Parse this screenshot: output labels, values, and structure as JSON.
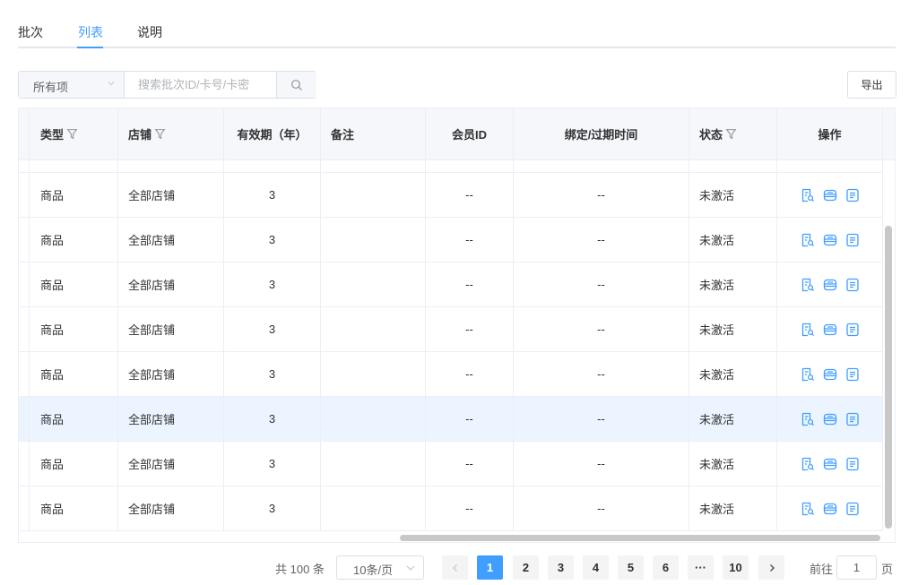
{
  "tabs": [
    {
      "label": "批次",
      "active": false
    },
    {
      "label": "列表",
      "active": true
    },
    {
      "label": "说明",
      "active": false
    }
  ],
  "search": {
    "select_value": "所有项",
    "placeholder": "搜索批次ID/卡号/卡密",
    "value": ""
  },
  "toolbar": {
    "export_label": "导出"
  },
  "table": {
    "columns": [
      "类型",
      "店铺",
      "有效期（年）",
      "备注",
      "会员ID",
      "绑定/过期时间",
      "状态",
      "操作"
    ],
    "rows": [
      {
        "type": "商品",
        "shop": "全部店铺",
        "validity": "3",
        "note": "",
        "member_id": "--",
        "time": "--",
        "status": "未激活"
      },
      {
        "type": "商品",
        "shop": "全部店铺",
        "validity": "3",
        "note": "",
        "member_id": "--",
        "time": "--",
        "status": "未激活"
      },
      {
        "type": "商品",
        "shop": "全部店铺",
        "validity": "3",
        "note": "",
        "member_id": "--",
        "time": "--",
        "status": "未激活"
      },
      {
        "type": "商品",
        "shop": "全部店铺",
        "validity": "3",
        "note": "",
        "member_id": "--",
        "time": "--",
        "status": "未激活"
      },
      {
        "type": "商品",
        "shop": "全部店铺",
        "validity": "3",
        "note": "",
        "member_id": "--",
        "time": "--",
        "status": "未激活"
      },
      {
        "type": "商品",
        "shop": "全部店铺",
        "validity": "3",
        "note": "",
        "member_id": "--",
        "time": "--",
        "status": "未激活",
        "highlighted": true
      },
      {
        "type": "商品",
        "shop": "全部店铺",
        "validity": "3",
        "note": "",
        "member_id": "--",
        "time": "--",
        "status": "未激活"
      },
      {
        "type": "商品",
        "shop": "全部店铺",
        "validity": "3",
        "note": "",
        "member_id": "--",
        "time": "--",
        "status": "未激活"
      }
    ],
    "row_actions": [
      "detail-search-icon",
      "card-icon",
      "document-icon"
    ]
  },
  "pagination": {
    "total_text": "共 100 条",
    "page_size": "10条/页",
    "pages": [
      "1",
      "2",
      "3",
      "4",
      "5",
      "6",
      "···",
      "10"
    ],
    "current": "1",
    "goto_label": "前往",
    "goto_value": "1",
    "goto_suffix": "页"
  },
  "colors": {
    "accent": "#409eff",
    "header_bg": "#f5f7fa",
    "row_highlight": "#ecf5ff",
    "border": "#ebeef5"
  }
}
